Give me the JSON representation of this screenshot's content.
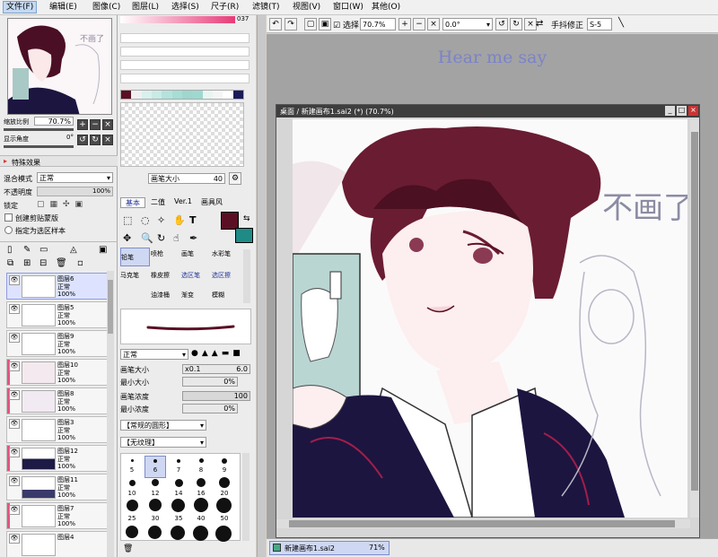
{
  "menu": [
    "文件(F)",
    "编辑(E)",
    "图像(C)",
    "图层(L)",
    "选择(S)",
    "尺子(R)",
    "滤镜(T)",
    "视图(V)",
    "窗口(W)",
    "其他(O)"
  ],
  "navigator": {
    "zoom_label": "缩放比例",
    "zoom": "70.7%",
    "angle_label": "显示角度",
    "angle": "0°"
  },
  "effects": {
    "title": "特殊效果"
  },
  "layer_props": {
    "blend_label": "混合模式",
    "blend_value": "正常",
    "opacity_label": "不透明度",
    "opacity_value": "100%",
    "lock_label": "锁定",
    "clip_label": "创建剪贴蒙版",
    "select_label": "指定为选区样本"
  },
  "layers": [
    {
      "name": "图层6",
      "mode": "正常",
      "opacity": "100%",
      "selected": true,
      "marked": false
    },
    {
      "name": "图层5",
      "mode": "正常",
      "opacity": "100%",
      "selected": false,
      "marked": false
    },
    {
      "name": "图层9",
      "mode": "正常",
      "opacity": "100%",
      "selected": false,
      "marked": false
    },
    {
      "name": "图层10",
      "mode": "正常",
      "opacity": "100%",
      "selected": false,
      "marked": true
    },
    {
      "name": "图层8",
      "mode": "正常",
      "opacity": "100%",
      "selected": false,
      "marked": true
    },
    {
      "name": "图层3",
      "mode": "正常",
      "opacity": "100%",
      "selected": false,
      "marked": false
    },
    {
      "name": "图层12",
      "mode": "正常",
      "opacity": "100%",
      "selected": false,
      "marked": true
    },
    {
      "name": "图层11",
      "mode": "正常",
      "opacity": "100%",
      "selected": false,
      "marked": false
    },
    {
      "name": "图层7",
      "mode": "正常",
      "opacity": "100%",
      "selected": false,
      "marked": true
    },
    {
      "name": "图层4",
      "mode": "",
      "opacity": "",
      "selected": false,
      "marked": false
    }
  ],
  "color": {
    "top_value": "037",
    "primary": "#5a0f24",
    "secondary": "#1f8b87",
    "swatches": [
      "#5a0f24",
      "#f0f0f0",
      "#d9f0ee",
      "#c8ebe6",
      "#b2e3dc",
      "#a6ddd5",
      "#9fd6cf",
      "#9ed9cf",
      "#e8f5f3",
      "#f5f5f5",
      "#ffffff",
      "#1a1a5a"
    ]
  },
  "brush_size": {
    "label": "画笔大小",
    "value": "40"
  },
  "tool_tabs": [
    "基本",
    "二值",
    "Ver.1",
    "画具风"
  ],
  "tools": [
    "铅笔",
    "喷枪",
    "画笔",
    "水彩笔",
    "马克笔",
    "橡皮擦",
    "选区笔",
    "选区擦",
    "",
    "油漆桶",
    "渐变",
    "模糊"
  ],
  "brush": {
    "mode": "正常",
    "size_label": "画笔大小",
    "size_mult": "x0.1",
    "size_value": "6.0",
    "min_size_label": "最小大小",
    "min_size_value": "0%",
    "density_label": "画笔浓度",
    "density_value": "100",
    "min_density_label": "最小浓度",
    "min_density_value": "0%",
    "shape": "【常规的圆形】",
    "texture": "【无纹理】"
  },
  "dot_sizes": [
    "5",
    "6",
    "7",
    "8",
    "9",
    "10",
    "12",
    "14",
    "16",
    "20",
    "25",
    "30",
    "35",
    "40",
    "50"
  ],
  "toolbar": {
    "select_label": "选择",
    "zoom": "70.7%",
    "angle": "0.0°",
    "stabilizer_label": "手抖修正",
    "stabilizer": "S-5"
  },
  "canvas": {
    "heading": "Hear me say",
    "window_title": "桌面 / 新建画布1.sai2 (*) (70.7%)",
    "sign": "不画了"
  },
  "taskbar": {
    "file": "新建画布1.sai2",
    "pct": "71%"
  }
}
